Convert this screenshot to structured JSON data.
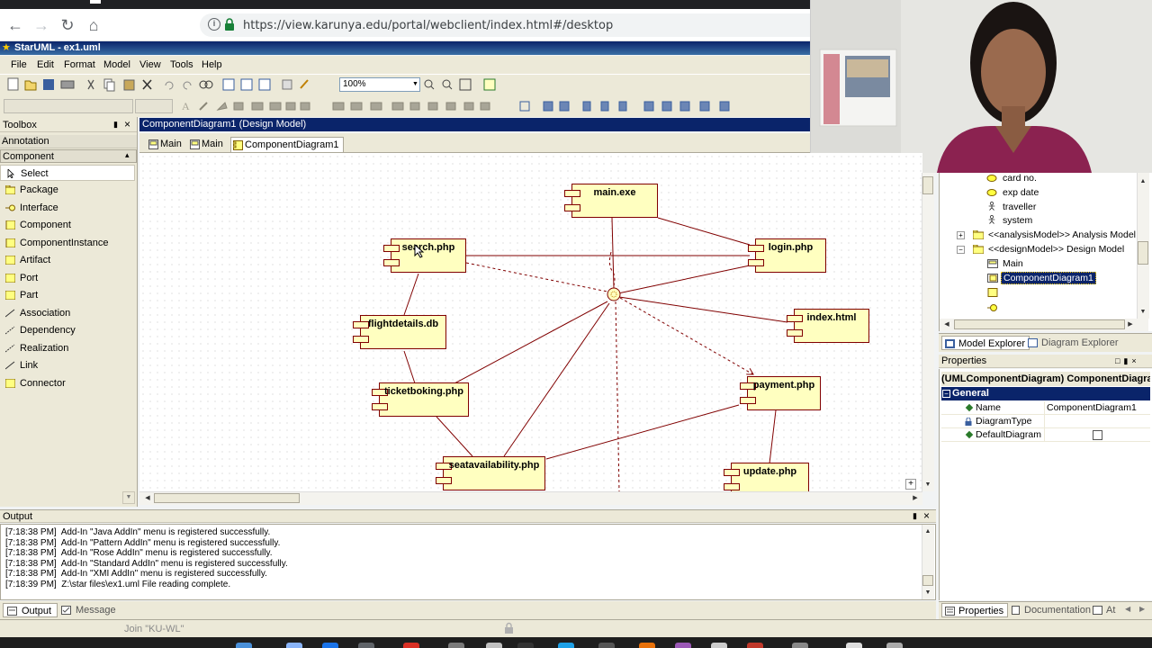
{
  "browser": {
    "url": "https://view.karunya.edu/portal/webclient/index.html#/desktop"
  },
  "app": {
    "title": "StarUML - ex1.uml",
    "menus": [
      "File",
      "Edit",
      "Format",
      "Model",
      "View",
      "Tools",
      "Help"
    ],
    "zoom": "100%"
  },
  "toolbox": {
    "header": "Toolbox",
    "section_annotation": "Annotation",
    "section_component": "Component",
    "tools": [
      "Select",
      "Package",
      "Interface",
      "Component",
      "ComponentInstance",
      "Artifact",
      "Port",
      "Part",
      "Association",
      "Dependency",
      "Realization",
      "Link",
      "Connector"
    ]
  },
  "diagram": {
    "header": "ComponentDiagram1 (Design Model)",
    "tabs": [
      "Main",
      "Main",
      "ComponentDiagram1"
    ],
    "components": [
      "main.exe",
      "search.php",
      "login.php",
      "flightdetails.db",
      "index.html",
      "ticketboking.php",
      "payment.php",
      "seatavailability.php",
      "update.php"
    ]
  },
  "explorer": {
    "items": {
      "card_no": "card no.",
      "exp_date": "exp date",
      "traveller": "traveller",
      "system": "system",
      "analysis_model": "<<analysisModel>> Analysis Model",
      "design_model": "<<designModel>> Design Model",
      "main": "Main",
      "component_diagram": "ComponentDiagram1"
    },
    "tabs": [
      "Model Explorer",
      "Diagram Explorer"
    ]
  },
  "properties": {
    "header": "Properties",
    "title": "(UMLComponentDiagram) ComponentDiagram1",
    "group": "General",
    "rows": [
      {
        "name": "Name",
        "value": "ComponentDiagram1"
      },
      {
        "name": "DiagramType",
        "value": ""
      },
      {
        "name": "DefaultDiagram",
        "value": ""
      }
    ],
    "tabs": [
      "Properties",
      "Documentation",
      "At"
    ]
  },
  "output": {
    "header": "Output",
    "lines": [
      "[7:18:38 PM]  Add-In \"Java AddIn\" menu is registered successfully.",
      "[7:18:38 PM]  Add-In \"Pattern AddIn\" menu is registered successfully.",
      "[7:18:38 PM]  Add-In \"Rose AddIn\" menu is registered successfully.",
      "[7:18:38 PM]  Add-In \"Standard AddIn\" menu is registered successfully.",
      "[7:18:38 PM]  Add-In \"XMI AddIn\" menu is registered successfully.",
      "[7:18:39 PM]  Z:\\star files\\ex1.uml File reading complete."
    ],
    "tabs": [
      "Output",
      "Message"
    ]
  },
  "status": {
    "join_text": "Join \"KU-WL\""
  }
}
